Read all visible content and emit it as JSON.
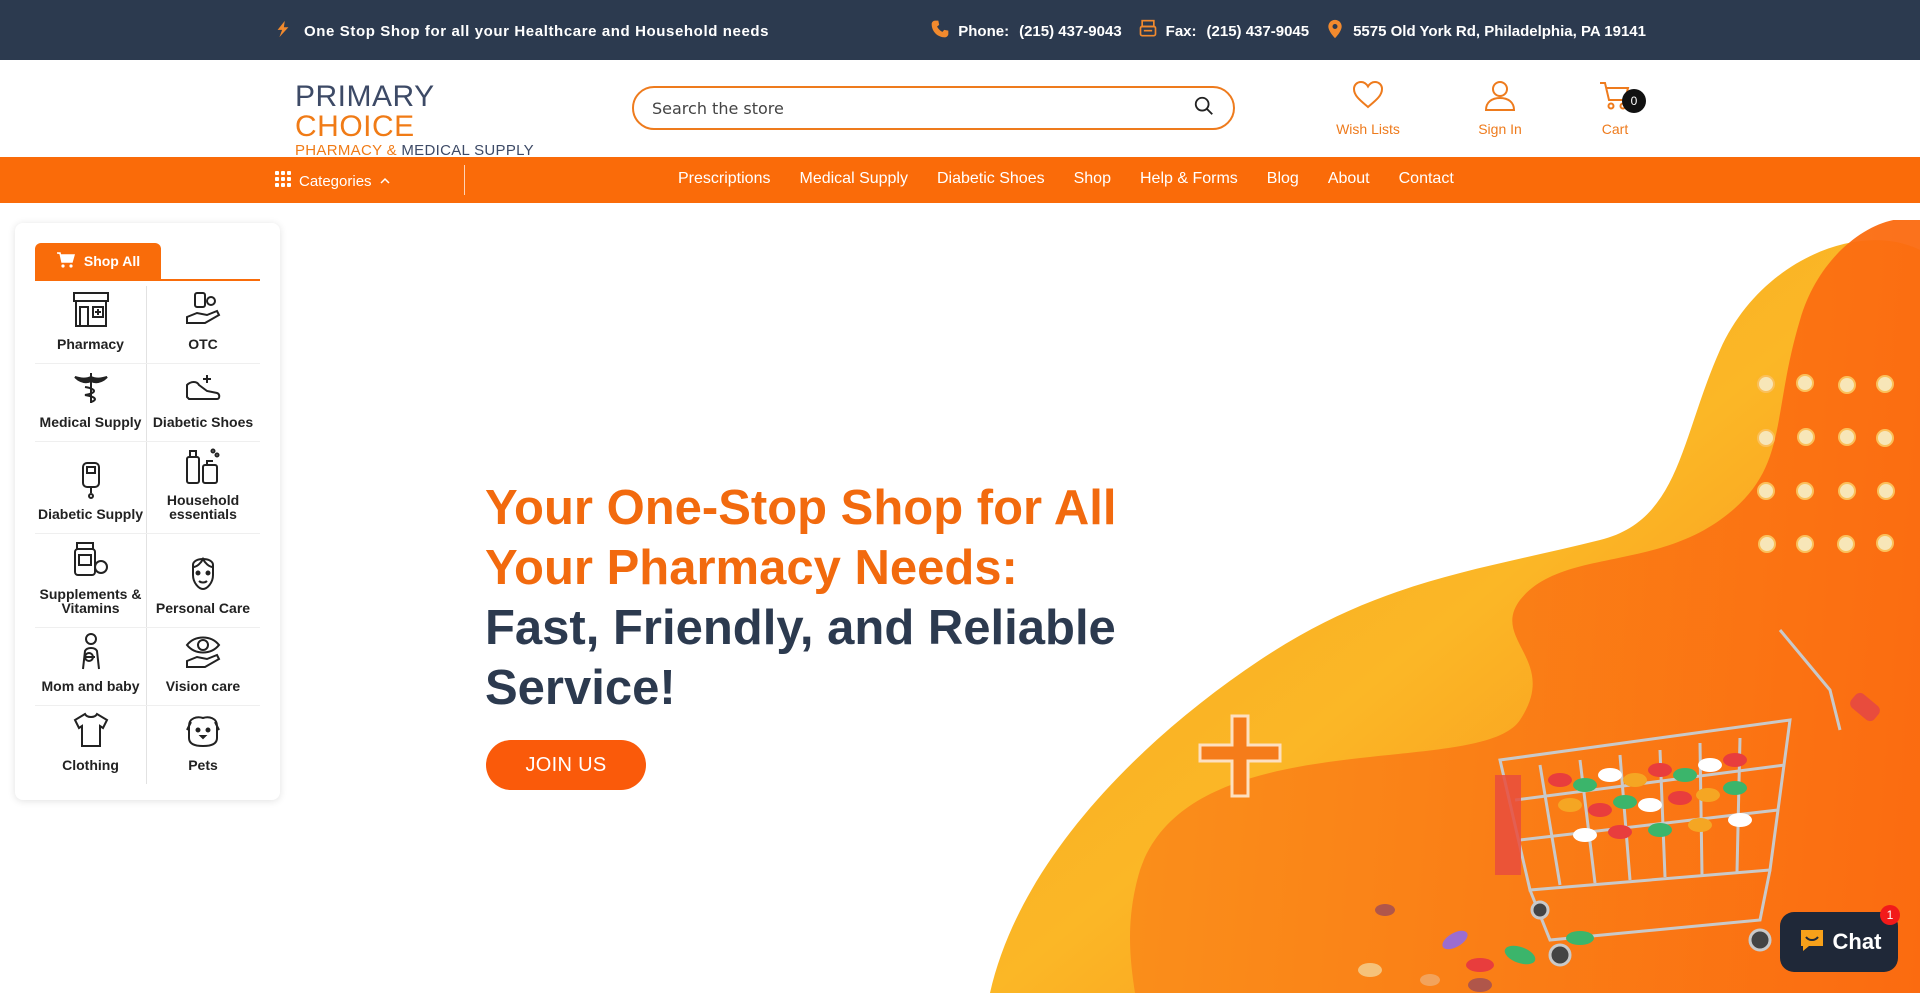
{
  "topbar": {
    "promo": "One Stop Shop for all your Healthcare and Household needs",
    "phone_label": "Phone:",
    "phone": "(215) 437-9043",
    "fax_label": "Fax:",
    "fax": "(215) 437-9045",
    "address": "5575 Old York Rd, Philadelphia, PA 19141"
  },
  "header": {
    "logo_line1_a": "PRIMARY ",
    "logo_line1_b": "CHOICE",
    "logo_line2_a": "PHARMACY & ",
    "logo_line2_b": "MEDICAL SUPPLY",
    "search_placeholder": "Search the store",
    "wishlists": "Wish Lists",
    "signin": "Sign In",
    "cart": "Cart",
    "cart_count": "0"
  },
  "nav": {
    "categories": "Categories",
    "links": [
      "Prescriptions",
      "Medical Supply",
      "Diabetic Shoes",
      "Shop",
      "Help & Forms",
      "Blog",
      "About",
      "Contact"
    ]
  },
  "sidebar": {
    "shop_all": "Shop All",
    "items": [
      {
        "label": "Pharmacy",
        "icon": "pharmacy-store-icon"
      },
      {
        "label": "OTC",
        "icon": "otc-hand-pills-icon"
      },
      {
        "label": "Medical Supply",
        "icon": "caduceus-icon"
      },
      {
        "label": "Diabetic Shoes",
        "icon": "shoe-icon"
      },
      {
        "label": "Diabetic Supply",
        "icon": "glucose-meter-icon"
      },
      {
        "label": "Household essentials",
        "icon": "household-bottles-icon"
      },
      {
        "label": "Supplements & Vitamins",
        "icon": "vitamin-bottle-icon"
      },
      {
        "label": "Personal Care",
        "icon": "face-care-icon"
      },
      {
        "label": "Mom and baby",
        "icon": "mother-baby-icon"
      },
      {
        "label": "Vision care",
        "icon": "eye-hand-icon"
      },
      {
        "label": "Clothing",
        "icon": "tshirt-icon"
      },
      {
        "label": "Pets",
        "icon": "pet-dog-icon"
      }
    ]
  },
  "hero": {
    "line1": "Your One-Stop Shop for All",
    "line2": "Your Pharmacy Needs:",
    "line3": "Fast, Friendly, and Reliable",
    "line4": "Service!",
    "button": "JOIN US"
  },
  "chat": {
    "label": "Chat",
    "badge": "1"
  },
  "colors": {
    "brand_orange": "#fa6b09",
    "navy": "#2c3a4f"
  }
}
